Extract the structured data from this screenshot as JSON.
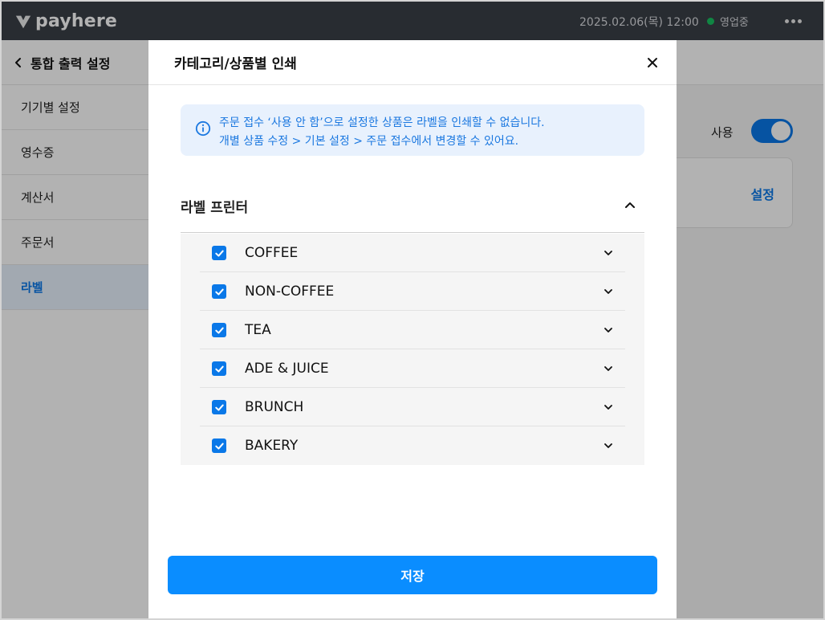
{
  "topbar": {
    "logo_text": "payhere",
    "datetime": "2025.02.06(목) 12:00",
    "status": "영업중",
    "status_color": "#18c060"
  },
  "sidebar": {
    "title": "통합 출력 설정",
    "items": [
      {
        "label": "기기별 설정",
        "active": false
      },
      {
        "label": "영수증",
        "active": false
      },
      {
        "label": "계산서",
        "active": false
      },
      {
        "label": "주문서",
        "active": false
      },
      {
        "label": "라벨",
        "active": true
      }
    ]
  },
  "main": {
    "use_label": "사용",
    "toggle_on": true,
    "card_link": "설정"
  },
  "modal": {
    "title": "카테고리/상품별 인쇄",
    "info_line1": "주문 접수 ‘사용 안 함’으로 설정한 상품은 라벨을 인쇄할 수 없습니다.",
    "info_line2": "개별 상품 수정 > 기본 설정 > 주문 접수에서 변경할 수 있어요.",
    "section_title": "라벨 프린터",
    "categories": [
      {
        "label": "COFFEE",
        "checked": true
      },
      {
        "label": "NON-COFFEE",
        "checked": true
      },
      {
        "label": "TEA",
        "checked": true
      },
      {
        "label": "ADE & JUICE",
        "checked": true
      },
      {
        "label": "BRUNCH",
        "checked": true
      },
      {
        "label": "BAKERY",
        "checked": true
      }
    ],
    "save_label": "저장"
  },
  "colors": {
    "accent": "#0a78e8",
    "save_button": "#0a8dff",
    "topbar": "#3a3f47",
    "info_background": "#e8f1fd"
  }
}
